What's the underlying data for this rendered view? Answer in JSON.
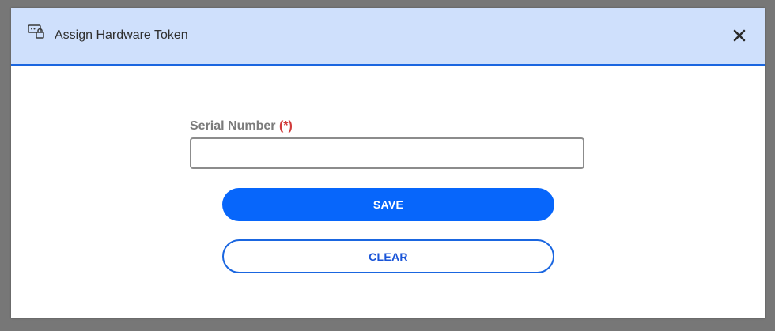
{
  "dialog": {
    "title": "Assign Hardware Token",
    "icon": "hardware-token-icon",
    "close_icon": "close-icon"
  },
  "form": {
    "serial_label": "Serial Number",
    "required_mark": "(*)",
    "serial_value": "",
    "serial_placeholder": ""
  },
  "actions": {
    "save_label": "SAVE",
    "clear_label": "CLEAR"
  },
  "colors": {
    "header_bg": "#cfe0fc",
    "accent": "#0766fb",
    "required": "#d13a3a"
  }
}
